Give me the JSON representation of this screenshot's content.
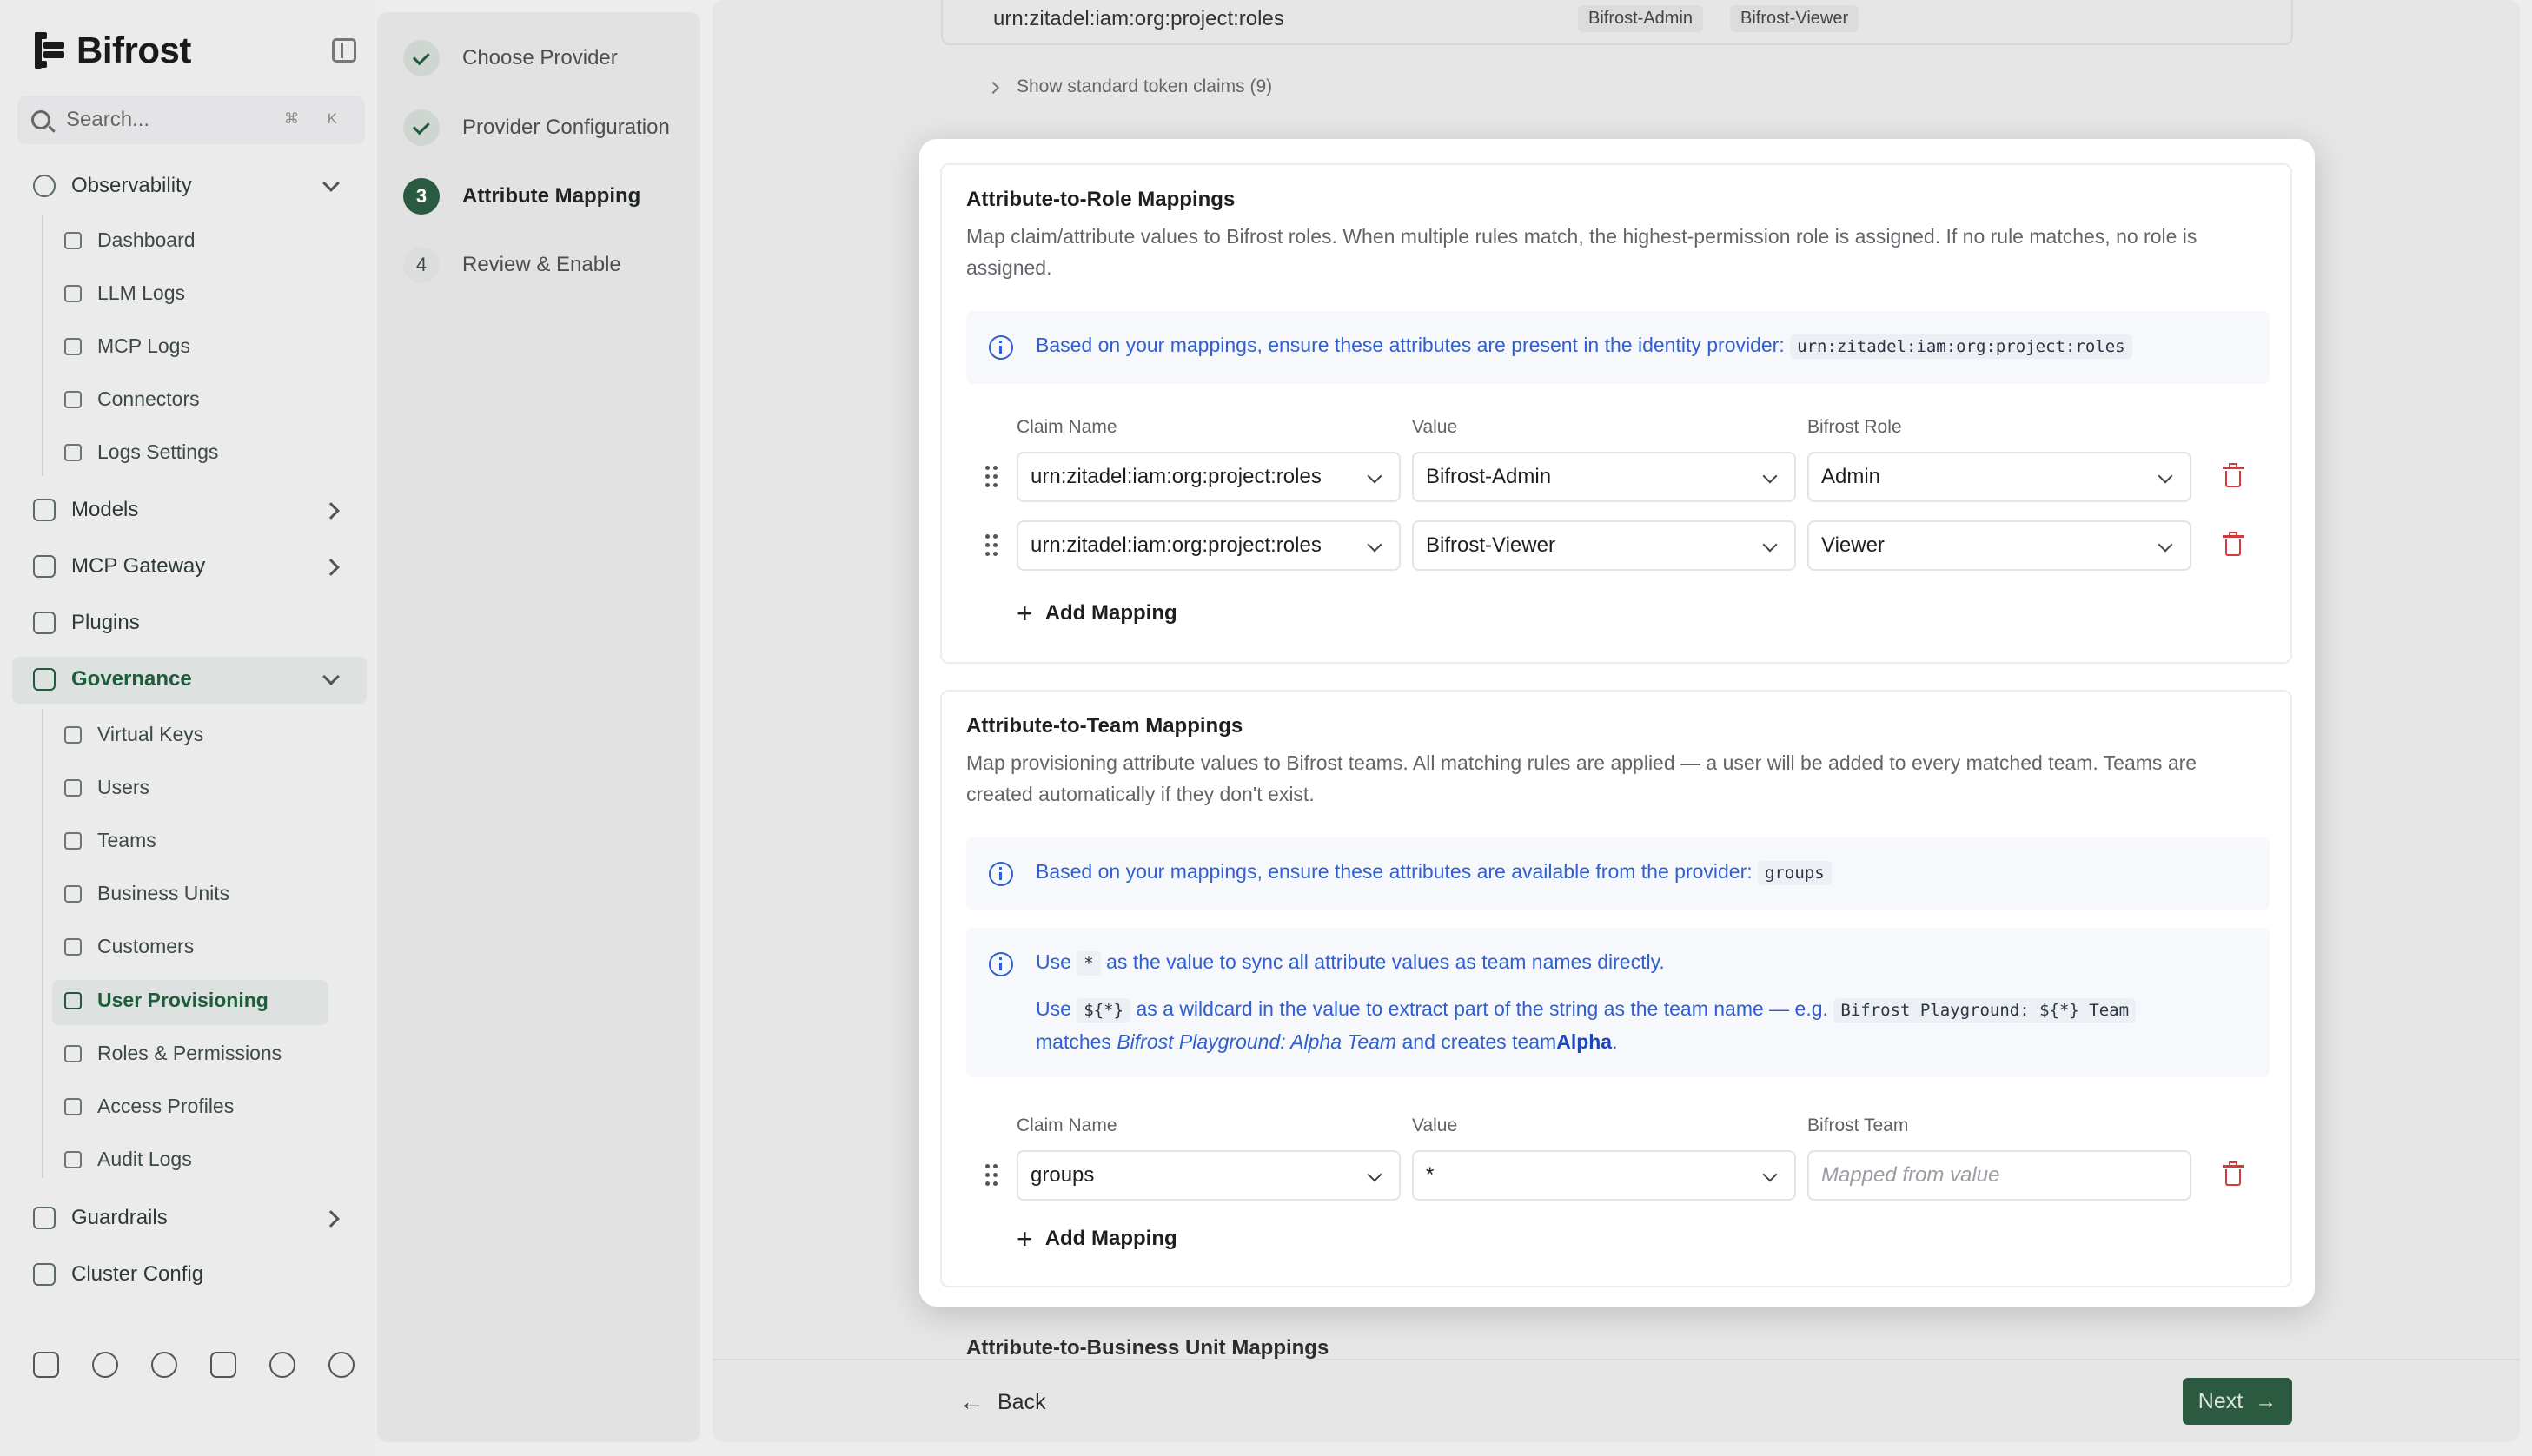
{
  "sidebar": {
    "brand": "Bifrost",
    "search_placeholder": "Search...",
    "search_shortcut": "⌘ K",
    "observability": {
      "label": "Observability",
      "items": [
        "Dashboard",
        "LLM Logs",
        "MCP Logs",
        "Connectors",
        "Logs Settings"
      ]
    },
    "models": "Models",
    "mcp_gateway": "MCP Gateway",
    "plugins": "Plugins",
    "governance": {
      "label": "Governance",
      "items": [
        "Virtual Keys",
        "Users",
        "Teams",
        "Business Units",
        "Customers",
        "User Provisioning",
        "Roles & Permissions",
        "Access Profiles",
        "Audit Logs"
      ],
      "active_item": "User Provisioning"
    },
    "guardrails": "Guardrails",
    "cluster_config": "Cluster Config"
  },
  "stepper": {
    "steps": [
      {
        "number": "",
        "label": "Choose Provider",
        "state": "done"
      },
      {
        "number": "",
        "label": "Provider Configuration",
        "state": "done"
      },
      {
        "number": "3",
        "label": "Attribute Mapping",
        "state": "current"
      },
      {
        "number": "4",
        "label": "Review & Enable",
        "state": "todo"
      }
    ]
  },
  "background": {
    "claim_name": "urn:zitadel:iam:org:project:roles",
    "claim_values": [
      "Bifrost-Admin",
      "Bifrost-Viewer"
    ],
    "show_claims": "Show standard token claims (9)",
    "business_unit_title": "Attribute-to-Business Unit Mappings"
  },
  "footer": {
    "back_label": "Back",
    "next_label": "Next"
  },
  "role_mappings": {
    "title": "Attribute-to-Role Mappings",
    "description": "Map claim/attribute values to Bifrost roles. When multiple rules match, the highest-permission role is assigned. If no rule matches, no role is assigned.",
    "info_prefix": "Based on your mappings, ensure these attributes are present in the identity provider:",
    "info_code": "urn:zitadel:iam:org:project:roles",
    "columns": [
      "Claim Name",
      "Value",
      "Bifrost Role"
    ],
    "rows": [
      {
        "claim": "urn:zitadel:iam:org:project:roles",
        "value": "Bifrost-Admin",
        "role": "Admin"
      },
      {
        "claim": "urn:zitadel:iam:org:project:roles",
        "value": "Bifrost-Viewer",
        "role": "Viewer"
      }
    ],
    "add_label": "Add Mapping"
  },
  "team_mappings": {
    "title": "Attribute-to-Team Mappings",
    "description": "Map provisioning attribute values to Bifrost teams. All matching rules are applied — a user will be added to every matched team. Teams are created automatically if they don't exist.",
    "info_prefix": "Based on your mappings, ensure these attributes are available from the provider:",
    "info_code": "groups",
    "hint": {
      "line1_pre": "Use",
      "line1_code": "*",
      "line1_post": "as the value to sync all attribute values as team names directly.",
      "line2_pre": "Use",
      "line2_code": "${*}",
      "line2_mid": "as a wildcard in the value to extract part of the string as the team name — e.g.",
      "line2_code2": "Bifrost Playground: ${*} Team",
      "line3_pre": "matches",
      "line3_italic": "Bifrost Playground: Alpha Team",
      "line3_mid": "and creates team",
      "line3_bold": "Alpha",
      "line3_end": "."
    },
    "columns": [
      "Claim Name",
      "Value",
      "Bifrost Team"
    ],
    "rows": [
      {
        "claim": "groups",
        "value": "*",
        "team_placeholder": "Mapped from value"
      }
    ],
    "add_label": "Add Mapping"
  },
  "colors": {
    "accent": "#2c5a41",
    "info_blue": "#2f5fd0",
    "danger": "#d23b3b"
  }
}
